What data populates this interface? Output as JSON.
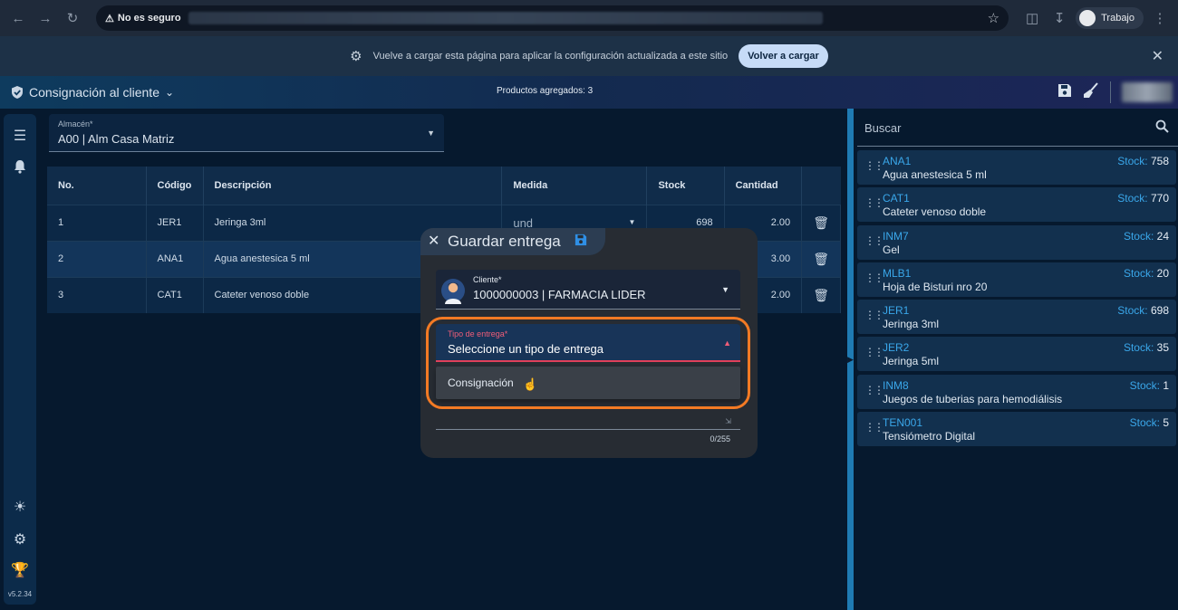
{
  "browser": {
    "security_label": "No es seguro",
    "profile_label": "Trabajo"
  },
  "infobar": {
    "message": "Vuelve a cargar esta página para aplicar la configuración actualizada a este sitio",
    "reload_label": "Volver a cargar"
  },
  "header": {
    "title": "Consignación al cliente",
    "products_added": "Productos agregados: 3"
  },
  "sidebar": {
    "version": "v5.2.34"
  },
  "warehouse": {
    "label": "Almacén*",
    "value": "A00 | Alm Casa Matriz"
  },
  "table": {
    "headers": [
      "No.",
      "Código",
      "Descripción",
      "Medida",
      "Stock",
      "Cantidad"
    ],
    "rows": [
      {
        "no": "1",
        "code": "JER1",
        "desc": "Jeringa 3ml",
        "unit": "und",
        "stock": "698",
        "qty": "2.00"
      },
      {
        "no": "2",
        "code": "ANA1",
        "desc": "Agua anestesica 5 ml",
        "unit": "",
        "stock": "",
        "qty": "3.00"
      },
      {
        "no": "3",
        "code": "CAT1",
        "desc": "Cateter venoso doble",
        "unit": "",
        "stock": "",
        "qty": "2.00"
      }
    ]
  },
  "search": {
    "placeholder": "Buscar"
  },
  "products": [
    {
      "code": "ANA1",
      "desc": "Agua anestesica 5 ml",
      "stock_label": "Stock:",
      "stock": "758"
    },
    {
      "code": "CAT1",
      "desc": "Cateter venoso doble",
      "stock_label": "Stock:",
      "stock": "770"
    },
    {
      "code": "INM7",
      "desc": "Gel",
      "stock_label": "Stock:",
      "stock": "24"
    },
    {
      "code": "MLB1",
      "desc": "Hoja de Bisturi nro 20",
      "stock_label": "Stock:",
      "stock": "20"
    },
    {
      "code": "JER1",
      "desc": "Jeringa 3ml",
      "stock_label": "Stock:",
      "stock": "698"
    },
    {
      "code": "JER2",
      "desc": "Jeringa 5ml",
      "stock_label": "Stock:",
      "stock": "35"
    },
    {
      "code": "INM8",
      "desc": "Juegos de tuberias para hemodiálisis",
      "stock_label": "Stock:",
      "stock": "1"
    },
    {
      "code": "TEN001",
      "desc": "Tensiómetro Digital",
      "stock_label": "Stock:",
      "stock": "5"
    }
  ],
  "modal": {
    "title": "Guardar entrega",
    "client_label": "Cliente*",
    "client_value": "1000000003 | FARMACIA LIDER",
    "delivery_label": "Tipo de entrega*",
    "delivery_value": "Seleccione un tipo de entrega",
    "options": [
      "Consignación"
    ],
    "char_counter": "0/255"
  },
  "colors": {
    "accent": "#3aa7ea",
    "error": "#e0405a",
    "highlight": "#f37a24",
    "delete": "#e53950"
  }
}
